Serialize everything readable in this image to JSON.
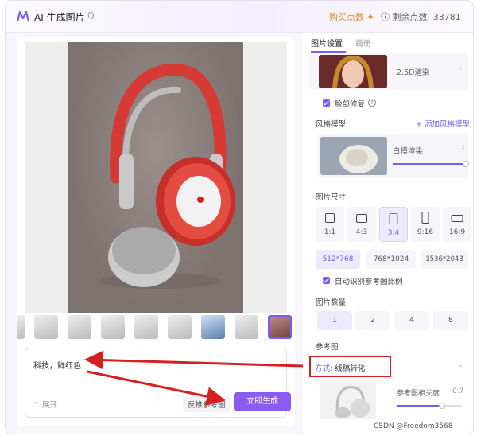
{
  "header": {
    "app_title": "AI 生成图片",
    "buy_label": "购买点数",
    "points_label": "剩余点数: 33781"
  },
  "prompt": {
    "text": "科技，鲜红色",
    "expand_label": "展开",
    "reverse_label": "反推参考图",
    "generate_label": "立即生成"
  },
  "right": {
    "tabs": [
      "图片设置",
      "画册"
    ],
    "model_name": "2.5D渲染",
    "face_fix_label": "脸部修复",
    "style_model_title": "风格模型",
    "add_style_label": "添加风格模型",
    "style_name": "白模渲染",
    "style_value": "1",
    "size_title": "图片尺寸",
    "ratios": [
      "1:1",
      "4:3",
      "3:4",
      "9:16",
      "16:9"
    ],
    "sizes": [
      "512*768",
      "768*1024",
      "1536*2048"
    ],
    "auto_ratio_label": "自动识别参考图比例",
    "count_title": "图片数量",
    "counts": [
      "1",
      "2",
      "4",
      "8"
    ],
    "ref_title": "参考图",
    "mode_prefix": "方式:",
    "mode_value": "线稿转化",
    "ref_relevance_label": "参考图相关度",
    "ref_relevance_value": "0.7"
  },
  "watermark": "CSDN @Freedom3568",
  "values": {
    "style_strength": 1,
    "ref_relevance": 0.7
  },
  "colors": {
    "accent": "#7c5cf0",
    "annotation": "#d42020",
    "buy": "#e08a1e"
  }
}
